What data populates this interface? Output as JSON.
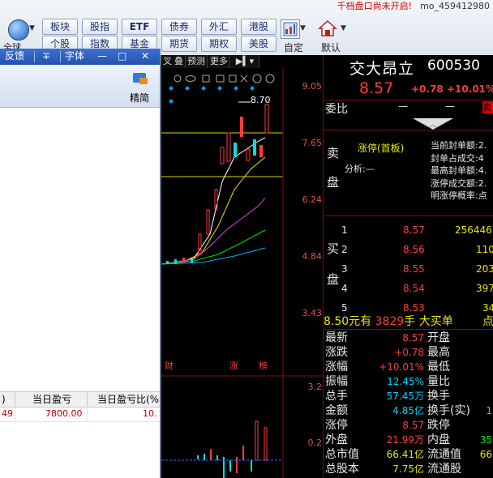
{
  "toolbar": {
    "notice": "千档盘口尚未开启!",
    "user": "mo_459412980",
    "globe_label": "全球",
    "buttons_row1": [
      "板块",
      "股指",
      "ETF",
      "债券",
      "外汇",
      "港股"
    ],
    "buttons_row2": [
      "个股",
      "指数",
      "基金",
      "期货",
      "期权",
      "美股"
    ],
    "custom_label": "自定",
    "default_label": "默认"
  },
  "window": {
    "title_items": [
      "反馈",
      "∓",
      "字体"
    ],
    "minimize": "—",
    "maximize": "□",
    "close": "✕",
    "brief_label": "精简",
    "table_headers": [
      ")",
      "当日盈亏",
      "当日盈亏比(%"
    ],
    "table_row": [
      "49",
      "7800.00",
      "10."
    ]
  },
  "chart": {
    "tabs": [
      "叉",
      "叠",
      "预测",
      "更多"
    ],
    "price_labels": [
      "9.05",
      "7.65",
      "6.24",
      "4.84",
      "3.43"
    ],
    "high_marker": "8.70",
    "volume_labels": [
      "3.2",
      "0.2"
    ],
    "event_markers": [
      "财",
      "涨",
      "榜"
    ]
  },
  "info": {
    "stock_name": "交大昂立",
    "stock_code": "600530",
    "price": "8.57",
    "change": "+0.78",
    "change_pct": "+10.01%",
    "weibi_label": "委比",
    "weibi_value": "—",
    "weibi_value2": "—",
    "sell_side_label": [
      "卖",
      "盘"
    ],
    "limit_status": "涨停(首板)",
    "analysis": "分析:—",
    "limit_details": [
      "当前封单额:2.",
      "封单占成交:4",
      "最高封单额:4.",
      "涨停成交额:2.",
      "明涨停概率:点"
    ],
    "buy_side_label": [
      "买",
      "盘"
    ],
    "bids": [
      {
        "level": "1",
        "price": "8.57",
        "vol": "256446"
      },
      {
        "level": "2",
        "price": "8.56",
        "vol": "110"
      },
      {
        "level": "3",
        "price": "8.55",
        "vol": "203"
      },
      {
        "level": "4",
        "price": "8.54",
        "vol": "397"
      },
      {
        "level": "5",
        "price": "8.53",
        "vol": "34"
      }
    ],
    "big_order": {
      "price": "8.50",
      "unit": "元有",
      "hands": "3829",
      "unit2": "手",
      "label": "大买单",
      "extra": "点"
    },
    "stats": [
      {
        "l": "最新",
        "v": "8.57",
        "c": "red",
        "r": "开盘",
        "rv": ""
      },
      {
        "l": "涨跌",
        "v": "+0.78",
        "c": "red",
        "r": "最高",
        "rv": ""
      },
      {
        "l": "涨幅",
        "v": "+10.01%",
        "c": "red",
        "r": "最低",
        "rv": ""
      },
      {
        "l": "振幅",
        "v": "12.45%",
        "c": "cyan",
        "r": "量比",
        "rv": ""
      },
      {
        "l": "总手",
        "v": "57.45万",
        "c": "cyan",
        "r": "换手",
        "rv": ""
      },
      {
        "l": "金额",
        "v": "4.85亿",
        "c": "cyan",
        "r": "换手(实)",
        "rv": "1"
      },
      {
        "l": "涨停",
        "v": "8.57",
        "c": "red",
        "r": "跌停",
        "rv": ""
      },
      {
        "l": "外盘",
        "v": "21.99万",
        "c": "red",
        "r": "内盘",
        "rv": "35"
      },
      {
        "l": "总市值",
        "v": "66.41亿",
        "c": "yel",
        "r": "流通值",
        "rv": "66"
      },
      {
        "l": "总股本",
        "v": "7.75亿",
        "c": "yel",
        "r": "流通股",
        "rv": ""
      }
    ]
  }
}
